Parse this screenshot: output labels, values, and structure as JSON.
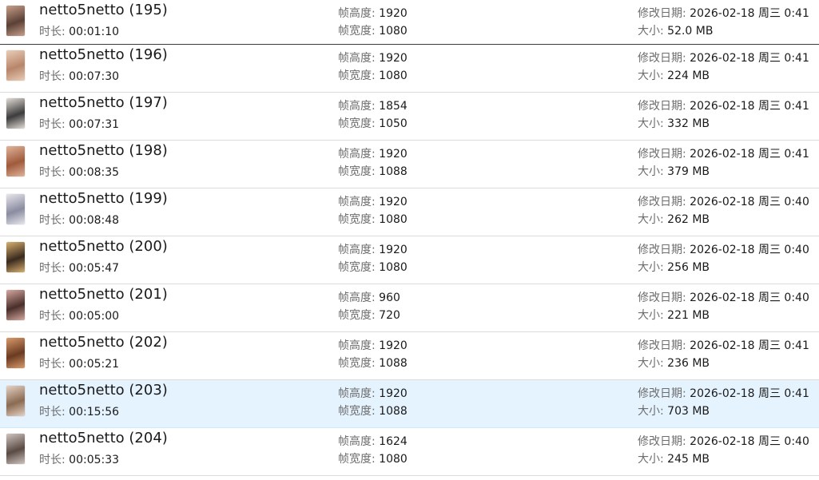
{
  "labels": {
    "duration": "时长:",
    "frame_height": "帧高度:",
    "frame_width": "帧宽度:",
    "modified": "修改日期:",
    "size": "大小:"
  },
  "files": [
    {
      "name": "netto5netto (195)",
      "duration": "00:01:10",
      "frame_height": "1920",
      "frame_width": "1080",
      "modified": "2026-02-18 周三 0:41",
      "size": "52.0 MB",
      "thumb_colors": [
        "#5a4036",
        "#c8a08a"
      ]
    },
    {
      "name": "netto5netto (196)",
      "duration": "00:07:30",
      "frame_height": "1920",
      "frame_width": "1080",
      "modified": "2026-02-18 周三 0:41",
      "size": "224 MB",
      "thumb_colors": [
        "#b8866a",
        "#e9cdb8"
      ]
    },
    {
      "name": "netto5netto (197)",
      "duration": "00:07:31",
      "frame_height": "1854",
      "frame_width": "1050",
      "modified": "2026-02-18 周三 0:41",
      "size": "332 MB",
      "thumb_colors": [
        "#3c3c3c",
        "#e2dcd6"
      ]
    },
    {
      "name": "netto5netto (198)",
      "duration": "00:08:35",
      "frame_height": "1920",
      "frame_width": "1088",
      "modified": "2026-02-18 周三 0:41",
      "size": "379 MB",
      "thumb_colors": [
        "#a05a3c",
        "#e0b49a"
      ]
    },
    {
      "name": "netto5netto (199)",
      "duration": "00:08:48",
      "frame_height": "1920",
      "frame_width": "1080",
      "modified": "2026-02-18 周三 0:40",
      "size": "262 MB",
      "thumb_colors": [
        "#8a8ca0",
        "#e8e6ee"
      ]
    },
    {
      "name": "netto5netto (200)",
      "duration": "00:05:47",
      "frame_height": "1920",
      "frame_width": "1080",
      "modified": "2026-02-18 周三 0:40",
      "size": "256 MB",
      "thumb_colors": [
        "#3a2a1e",
        "#d8b070"
      ]
    },
    {
      "name": "netto5netto (201)",
      "duration": "00:05:00",
      "frame_height": "960",
      "frame_width": "720",
      "modified": "2026-02-18 周三 0:40",
      "size": "221 MB",
      "thumb_colors": [
        "#4a2e2a",
        "#d4a8a0"
      ]
    },
    {
      "name": "netto5netto (202)",
      "duration": "00:05:21",
      "frame_height": "1920",
      "frame_width": "1088",
      "modified": "2026-02-18 周三 0:41",
      "size": "236 MB",
      "thumb_colors": [
        "#6a3a22",
        "#d89a6a"
      ]
    },
    {
      "name": "netto5netto (203)",
      "duration": "00:15:56",
      "frame_height": "1920",
      "frame_width": "1088",
      "modified": "2026-02-18 周三 0:41",
      "size": "703 MB",
      "thumb_colors": [
        "#8a6a52",
        "#e6d2c4"
      ],
      "selected": true
    },
    {
      "name": "netto5netto (204)",
      "duration": "00:05:33",
      "frame_height": "1624",
      "frame_width": "1080",
      "modified": "2026-02-18 周三 0:40",
      "size": "245 MB",
      "thumb_colors": [
        "#5a4a44",
        "#cfc4be"
      ]
    }
  ],
  "colors": {
    "selected_row": "#e5f3ff",
    "label_text": "#6d6d6d",
    "value_text": "#1a1a1a"
  }
}
